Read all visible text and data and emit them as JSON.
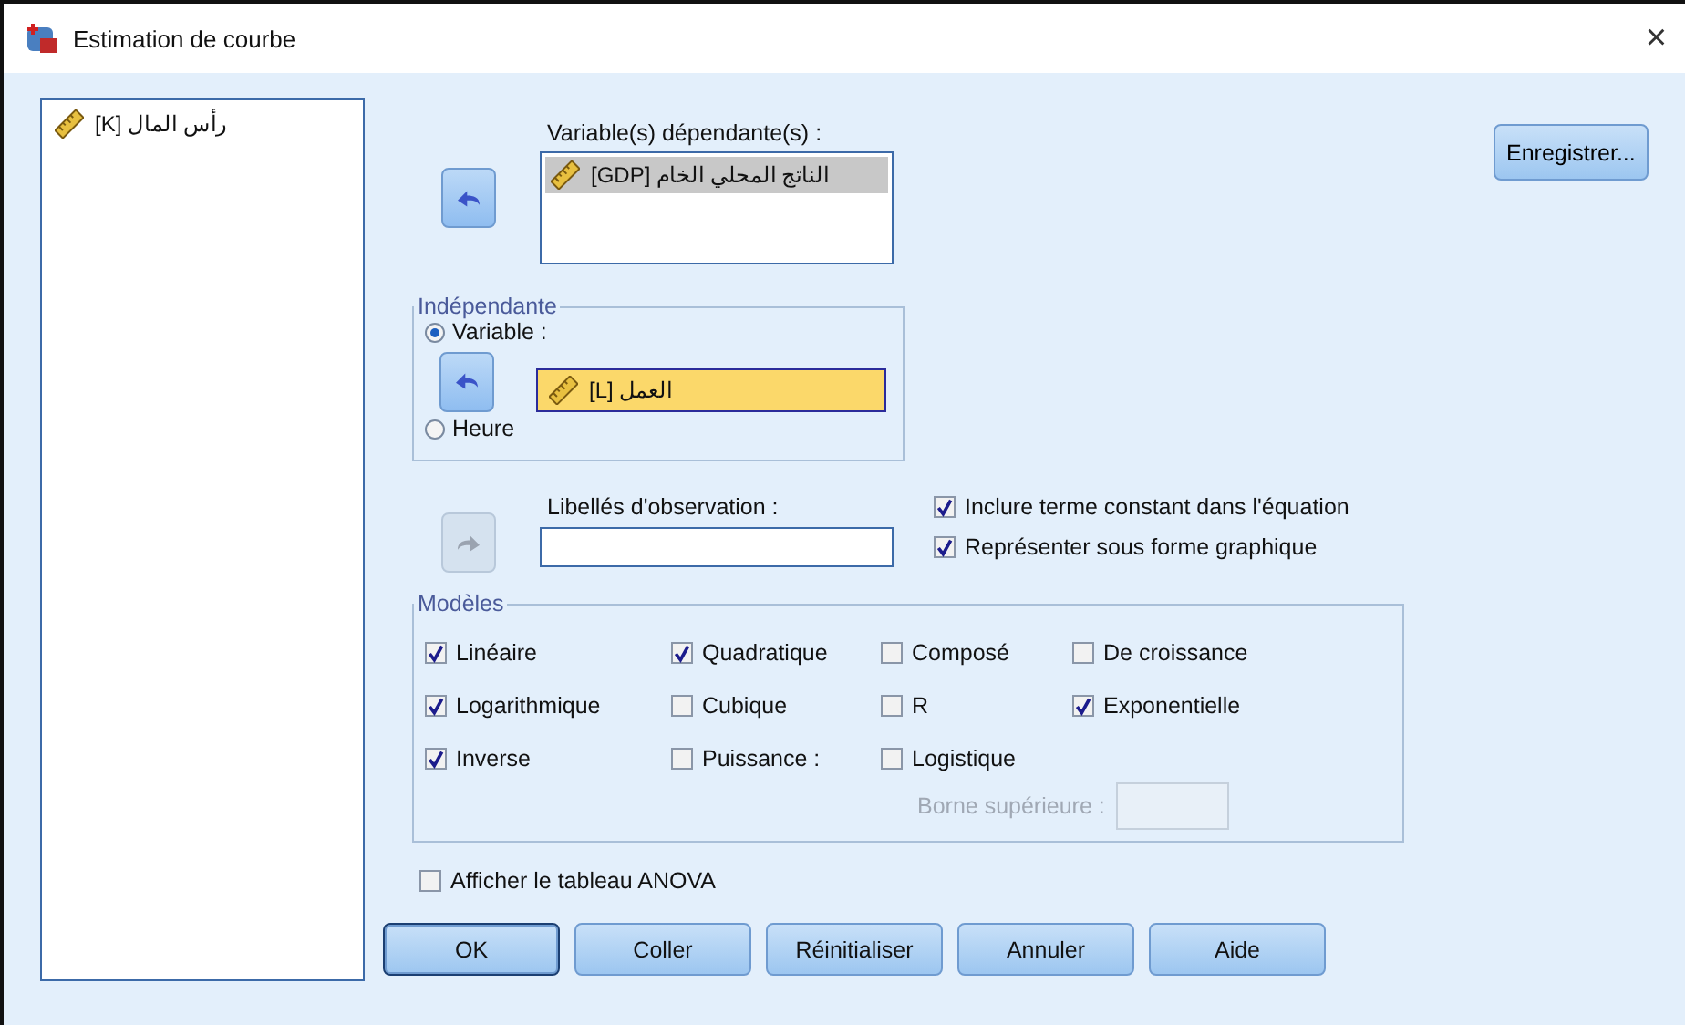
{
  "window": {
    "title": "Estimation de courbe",
    "close": "×"
  },
  "source_list": {
    "items": [
      {
        "label": "رأس المال [K]",
        "selected": false
      }
    ]
  },
  "dependent": {
    "label": "Variable(s) dépendante(s) :",
    "items": [
      {
        "label": "الناتج المحلي الخام [GDP]",
        "selected": true
      }
    ]
  },
  "save_button": "Enregistrer...",
  "independent": {
    "title": "Indépendante",
    "options": [
      {
        "label": "Variable :",
        "selected": true
      },
      {
        "label": "Heure",
        "selected": false
      }
    ],
    "variable_value": "العمل [L]"
  },
  "case_labels": {
    "label": "Libellés d'observation :",
    "move_disabled": true
  },
  "options": [
    {
      "label": "Inclure terme constant dans l'équation",
      "checked": true
    },
    {
      "label": "Représenter sous forme graphique",
      "checked": true
    }
  ],
  "models": {
    "title": "Modèles",
    "items": [
      {
        "label": "Linéaire",
        "checked": true
      },
      {
        "label": "Quadratique",
        "checked": true
      },
      {
        "label": "Composé",
        "checked": false
      },
      {
        "label": "De croissance",
        "checked": false
      },
      {
        "label": "Logarithmique",
        "checked": true
      },
      {
        "label": "Cubique",
        "checked": false
      },
      {
        "label": "R",
        "checked": false
      },
      {
        "label": "Exponentielle",
        "checked": true
      },
      {
        "label": "Inverse",
        "checked": true
      },
      {
        "label": "Puissance :",
        "checked": false
      },
      {
        "label": "Logistique",
        "checked": false
      }
    ],
    "upper_bound": {
      "label": "Borne supérieure :",
      "disabled": true
    }
  },
  "anova": {
    "label": "Afficher le tableau ANOVA",
    "checked": false
  },
  "buttons": [
    {
      "label": "OK",
      "default": true
    },
    {
      "label": "Coller",
      "default": false
    },
    {
      "label": "Réinitialiser",
      "default": false
    },
    {
      "label": "Annuler",
      "default": false
    },
    {
      "label": "Aide",
      "default": false
    }
  ]
}
